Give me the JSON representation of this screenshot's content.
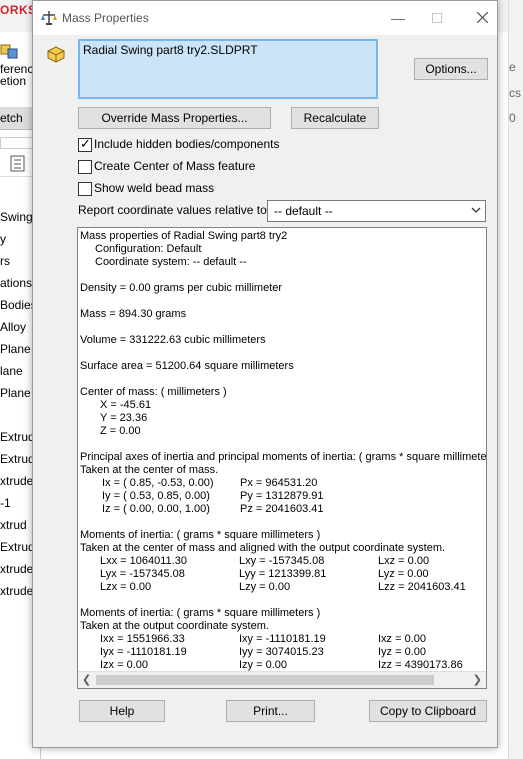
{
  "background": {
    "brand": "ORKS",
    "cmd_lines": [
      "ferenc",
      "etion"
    ],
    "tab": "etch",
    "tree_items": [
      "Swing",
      "y",
      "rs",
      "ations",
      "Bodies",
      "Alloy",
      "Plane",
      "lane",
      "Plane",
      "",
      "Extrud",
      "Extrud",
      "xtrude",
      "-1",
      "xtrud",
      "Extrud",
      "xtrude",
      "xtrude"
    ],
    "right_texts": [
      "e",
      "cs",
      "0"
    ]
  },
  "dialog": {
    "title": "Mass Properties",
    "part_name": "Radial Swing part8 try2.SLDPRT",
    "options_label": "Options...",
    "override_label": "Override Mass Properties...",
    "recalculate_label": "Recalculate",
    "checkboxes": [
      {
        "label": "Include hidden bodies/components",
        "checked": true
      },
      {
        "label": "Create Center of Mass feature",
        "checked": false
      },
      {
        "label": "Show weld bead mass",
        "checked": false
      }
    ],
    "report_label": "Report coordinate values relative to:",
    "coord_select_value": "-- default --",
    "help_label": "Help",
    "print_label": "Print...",
    "copy_label": "Copy to Clipboard"
  },
  "results": {
    "header": "Mass properties of Radial Swing part8 try2",
    "config": "Configuration: Default",
    "coordsys": "Coordinate system: -- default --",
    "density": "Density = 0.00 grams per cubic millimeter",
    "mass": "Mass = 894.30 grams",
    "volume": "Volume = 331222.63 cubic millimeters",
    "surface_area": "Surface area = 51200.64  square millimeters",
    "com_title": "Center of mass: ( millimeters )",
    "com_x": "X = -45.61",
    "com_y": "Y = 23.36",
    "com_z": "Z = 0.00",
    "pa_title": "Principal axes of inertia and principal moments of inertia: ( grams *  square millimeters )",
    "pa_sub": "Taken at the center of mass.",
    "ix": "Ix = ( 0.85, -0.53,  0.00)",
    "iy": "Iy = ( 0.53,  0.85,  0.00)",
    "iz": "Iz = ( 0.00,  0.00,  1.00)",
    "px": "Px = 964531.20",
    "py": "Py = 1312879.91",
    "pz": "Pz = 2041603.41",
    "moi1_title": "Moments of inertia: ( grams *  square millimeters )",
    "moi1_sub": "Taken at the center of mass and aligned with the output coordinate system.",
    "lxx": "Lxx = 1064011.30",
    "lxy": "Lxy = -157345.08",
    "lxz": "Lxz = 0.00",
    "lyx": "Lyx = -157345.08",
    "lyy": "Lyy = 1213399.81",
    "lyz": "Lyz = 0.00",
    "lzx": "Lzx = 0.00",
    "lzy": "Lzy = 0.00",
    "lzz": "Lzz = 2041603.41",
    "moi2_title": "Moments of inertia: ( grams *  square millimeters )",
    "moi2_sub": "Taken at the output coordinate system.",
    "ixx": "Ixx = 1551966.33",
    "ixy": "Ixy = -1110181.19",
    "ixz": "Ixz = 0.00",
    "iyx": "Iyx = -1110181.19",
    "iyy": "Iyy = 3074015.23",
    "iyz": "Iyz = 0.00",
    "izx": "Izx = 0.00",
    "izy": "Izy = 0.00",
    "izz": "Izz = 4390173.86"
  },
  "colors": {
    "brand_red": "#d4222a",
    "selection_fill": "#cce4f7",
    "selection_border": "#78b6ea",
    "dialog_bg": "#f0f0f0"
  },
  "icons": {
    "title": "mass-properties-icon",
    "part": "part-icon",
    "minimize": "minimize-icon",
    "maximize": "maximize-icon",
    "close": "close-icon",
    "dropdown": "chevron-down-icon",
    "scroll_left": "scroll-left-icon",
    "scroll_right": "scroll-right-icon"
  }
}
